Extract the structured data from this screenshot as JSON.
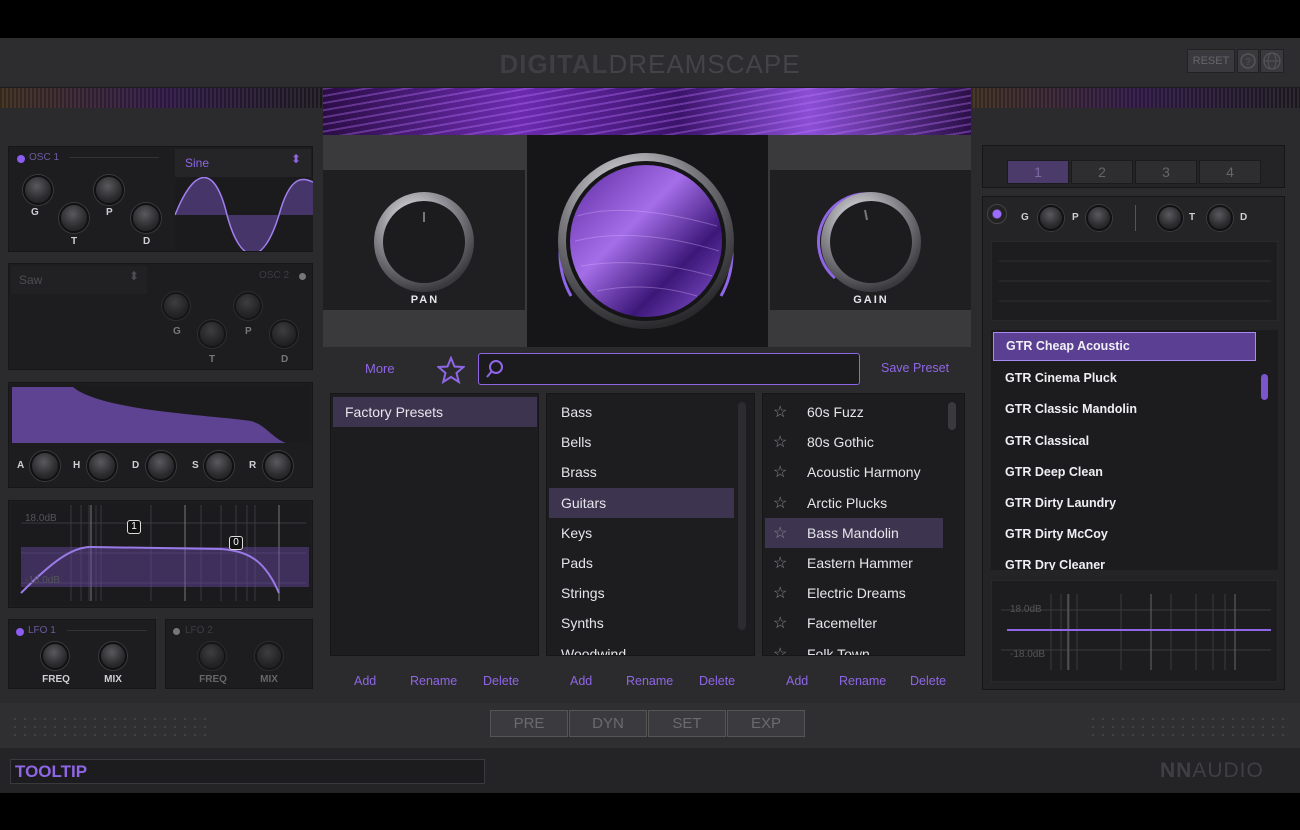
{
  "header": {
    "brand_bold": "DIGITAL",
    "brand_light": "DREAMSCAPE",
    "reset_label": "RESET",
    "help_icon": "question-icon",
    "globe_icon": "globe-icon"
  },
  "osc1": {
    "label": "OSC 1",
    "wave": "Sine",
    "knobs": [
      "G",
      "P",
      "T",
      "D"
    ]
  },
  "osc2": {
    "wave": "Saw",
    "label": "OSC 2",
    "knobs": [
      "G",
      "P",
      "T",
      "D"
    ]
  },
  "envelope": {
    "knobs": [
      "A",
      "H",
      "D",
      "S",
      "R"
    ]
  },
  "filter": {
    "top_db": "18.0dB",
    "bottom_db": "-18.0dB",
    "band1": "1",
    "band2": "0"
  },
  "lfo1": {
    "label": "LFO 1",
    "freq": "FREQ",
    "mix": "MIX"
  },
  "lfo2": {
    "label": "LFO 2",
    "freq": "FREQ",
    "mix": "MIX"
  },
  "center": {
    "pan_label": "PAN",
    "gain_label": "GAIN"
  },
  "browser": {
    "more_label": "More",
    "save_label": "Save Preset",
    "search_placeholder": "",
    "banks": [
      "Factory Presets"
    ],
    "categories": [
      "Bass",
      "Bells",
      "Brass",
      "Guitars",
      "Keys",
      "Pads",
      "Strings",
      "Synths",
      "Woodwind"
    ],
    "selected_category": "Guitars",
    "presets": [
      "60s Fuzz",
      "80s Gothic",
      "Acoustic Harmony",
      "Arctic Plucks",
      "Bass Mandolin",
      "Eastern Hammer",
      "Electric Dreams",
      "Facemelter",
      "Folk Town"
    ],
    "selected_preset": "Bass Mandolin",
    "add": "Add",
    "rename": "Rename",
    "delete": "Delete"
  },
  "right": {
    "tabs": [
      "1",
      "2",
      "3",
      "4"
    ],
    "knobs": [
      "G",
      "P",
      "T",
      "D"
    ],
    "presets": [
      "GTR Cheap Acoustic",
      "GTR Cinema Pluck",
      "GTR Classic Mandolin",
      "GTR Classical",
      "GTR Deep Clean",
      "GTR Dirty Laundry",
      "GTR Dirty McCoy",
      "GTR Dry Cleaner"
    ],
    "selected": "GTR Cheap Acoustic",
    "eq_top": "18.0dB",
    "eq_bottom": "-18.0dB"
  },
  "bottom_tabs": [
    "PRE",
    "DYN",
    "SET",
    "EXP"
  ],
  "footer": {
    "tooltip": "TOOLTIP",
    "brand_bold": "NN",
    "brand_light": "AUDIO"
  },
  "colors": {
    "accent": "#8f66e6",
    "selection": "#5b3f92",
    "background": "#2b2b2d"
  }
}
